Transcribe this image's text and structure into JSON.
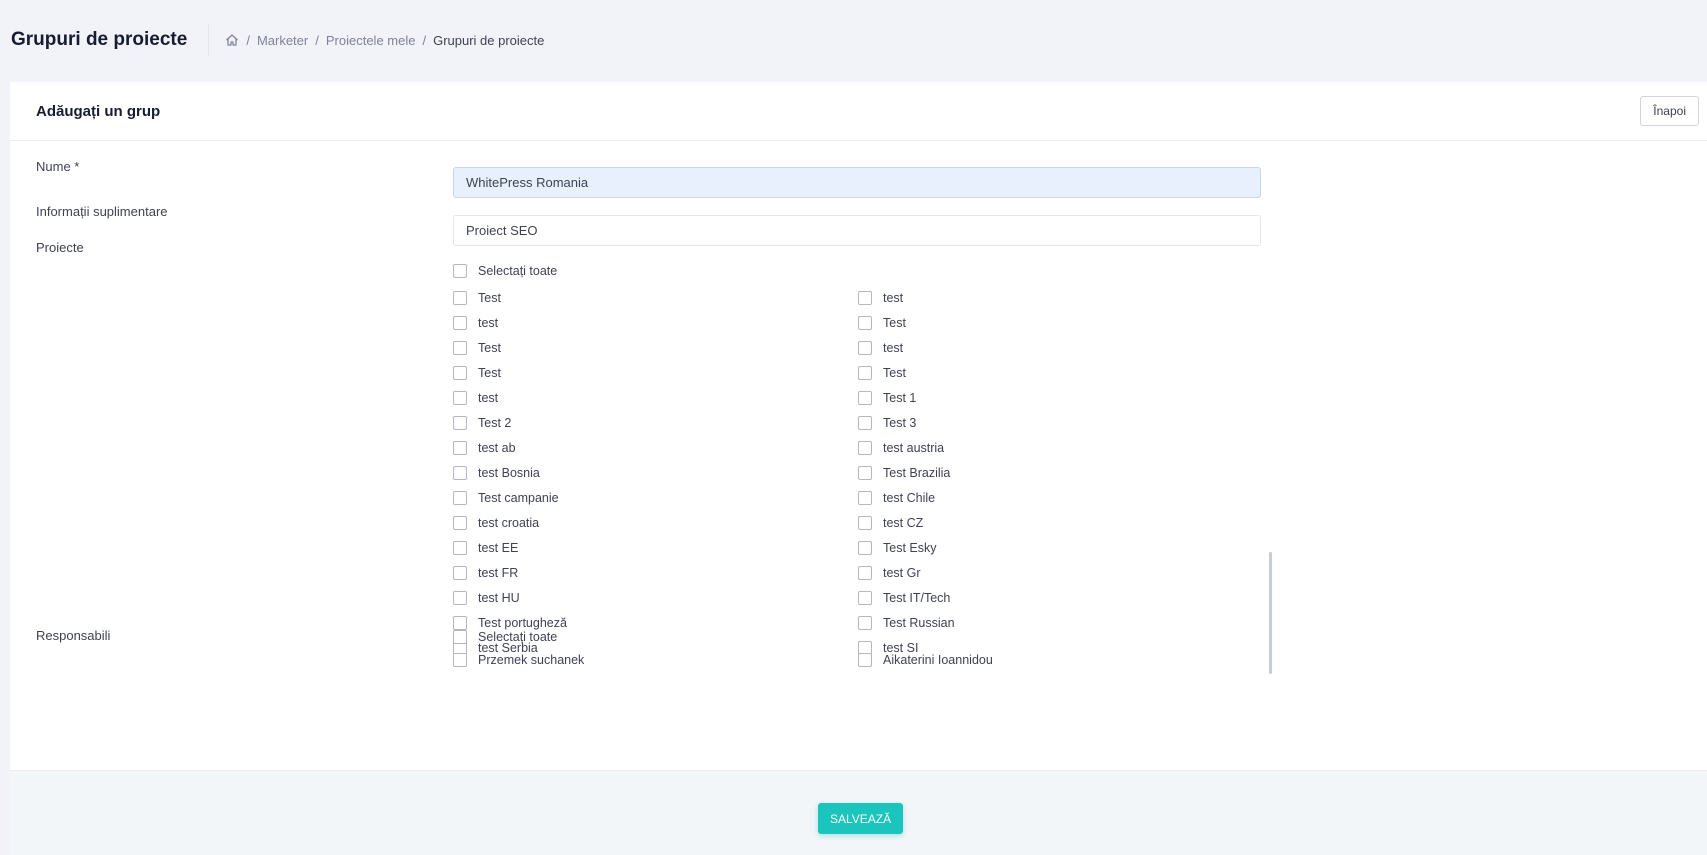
{
  "page": {
    "title": "Grupuri de proiecte",
    "breadcrumb": [
      "Marketer",
      "Proiectele mele",
      "Grupuri de proiecte"
    ]
  },
  "card": {
    "title": "Adăugați un grup",
    "back_label": "Înapoi"
  },
  "form": {
    "name_label": "Nume *",
    "name_value": "WhitePress Romania",
    "info_label": "Informații suplimentare",
    "info_value": "Proiect SEO",
    "projects_label": "Proiecte",
    "select_all_label": "Selectați toate",
    "projects": [
      "Test",
      "test",
      "test",
      "Test",
      "Test",
      "test",
      "Test",
      "Test",
      "test",
      "Test 1",
      "Test 2",
      "Test 3",
      "test ab",
      "test austria",
      "test Bosnia",
      "Test Brazilia",
      "Test campanie",
      "test Chile",
      "test croatia",
      "test CZ",
      "test EE",
      "Test Esky",
      "test FR",
      "test Gr",
      "test HU",
      "Test IT/Tech",
      "Test portugheză",
      "Test Russian",
      "test Serbia",
      "test SI"
    ],
    "responsible_label": "Responsabili",
    "responsible_select_all_label": "Selectați toate",
    "responsible": [
      "Przemek suchanek",
      "Aikaterini Ioannidou"
    ]
  },
  "footer": {
    "save_label": "SALVEAZĂ"
  },
  "colors": {
    "accent": "#1bc5bd",
    "filled_input": "#e8f0fe",
    "background": "#f2f3f8"
  }
}
